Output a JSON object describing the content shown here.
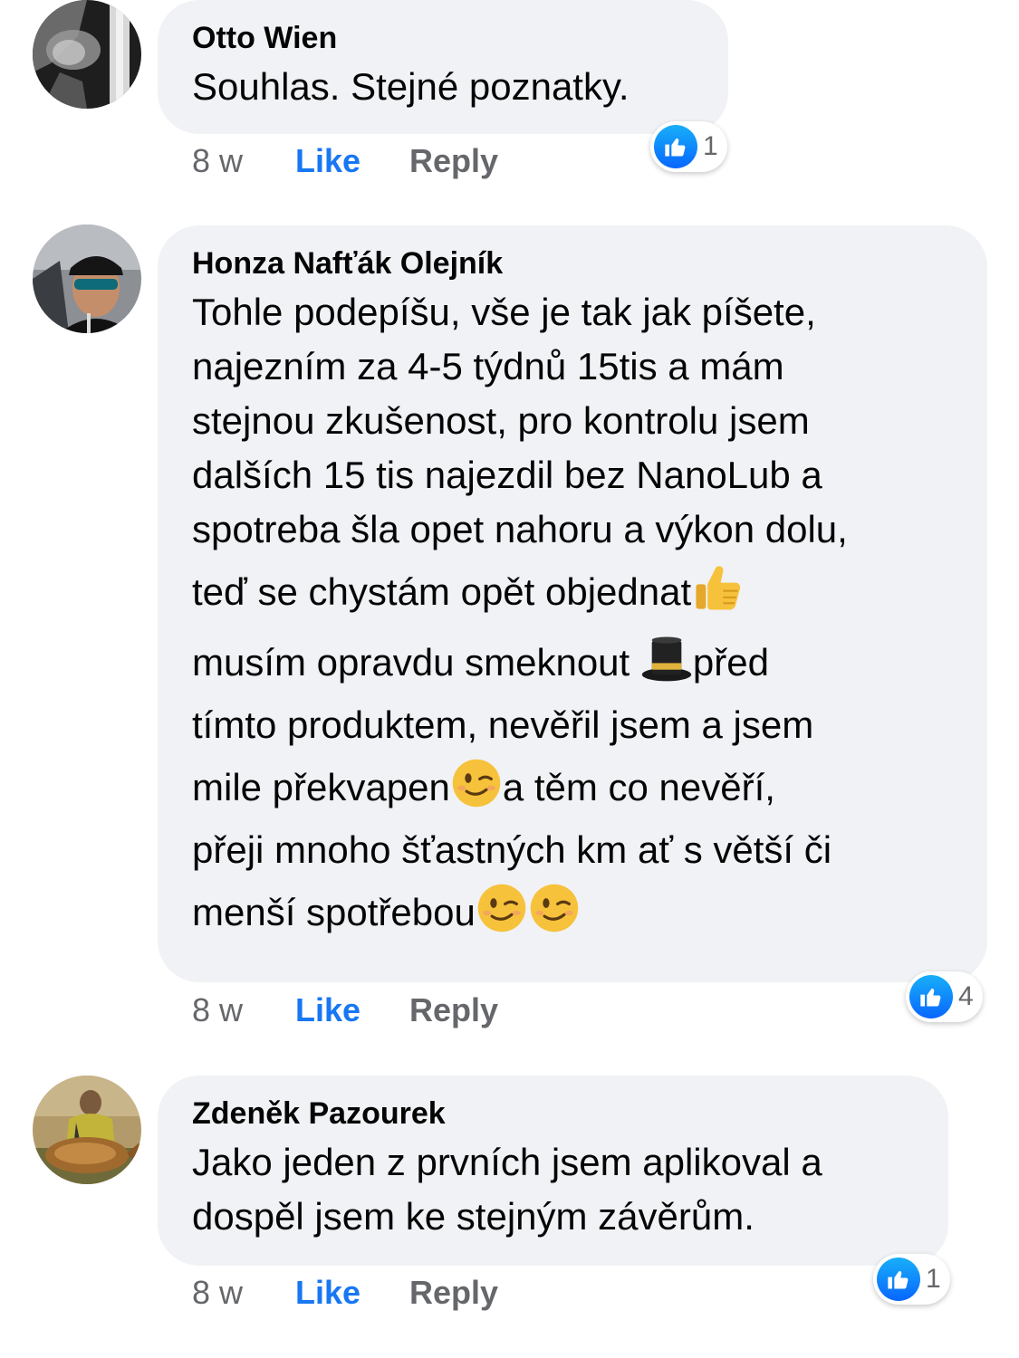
{
  "comments": [
    {
      "author": "Otto Wien",
      "avatar_icon": "xray-avatar",
      "lines": [
        "Souhlas. Stejné poznatky."
      ],
      "time": "8 w",
      "like_label": "Like",
      "reply_label": "Reply",
      "reaction_icon": "like-icon",
      "reaction_count": "1"
    },
    {
      "author": "Honza Nafťák Olejník",
      "avatar_icon": "man-cap-sunglasses-avatar",
      "lines": [
        "Tohle podepíšu, vše je tak jak píšete,",
        "najezním za 4-5 týdnů 15tis a mám",
        "stejnou zkušenost, pro kontrolu jsem",
        "dalších 15 tis najezdil bez NanoLub a",
        "spotreba šla opet nahoru a výkon dolu,",
        "teď se chystám opět objednat",
        "musím opravdu smeknout ",
        "před",
        "tímto produktem, nevěřil jsem a jsem",
        "mile překvapen",
        "a těm co nevěří,",
        "přeji mnoho šťastných km ať s větší či",
        "menší spotřebou"
      ],
      "emojis": {
        "thumbs": "thumbs-up-emoji",
        "hat": "top-hat-emoji",
        "wink": "winking-face-emoji"
      },
      "time": "8 w",
      "like_label": "Like",
      "reply_label": "Reply",
      "reaction_icon": "like-icon",
      "reaction_count": "4"
    },
    {
      "author": "Zdeněk Pazourek",
      "avatar_icon": "fisherman-carp-avatar",
      "lines": [
        "Jako jeden z prvních jsem aplikoval a",
        "dospěl jsem ke stejným závěrům."
      ],
      "time": "8 w",
      "like_label": "Like",
      "reply_label": "Reply",
      "reaction_icon": "like-icon",
      "reaction_count": "1"
    }
  ],
  "colors": {
    "bubble": "#f0f2f5",
    "like_blue": "#1877f2",
    "meta_gray": "#65676b",
    "text": "#050505"
  }
}
